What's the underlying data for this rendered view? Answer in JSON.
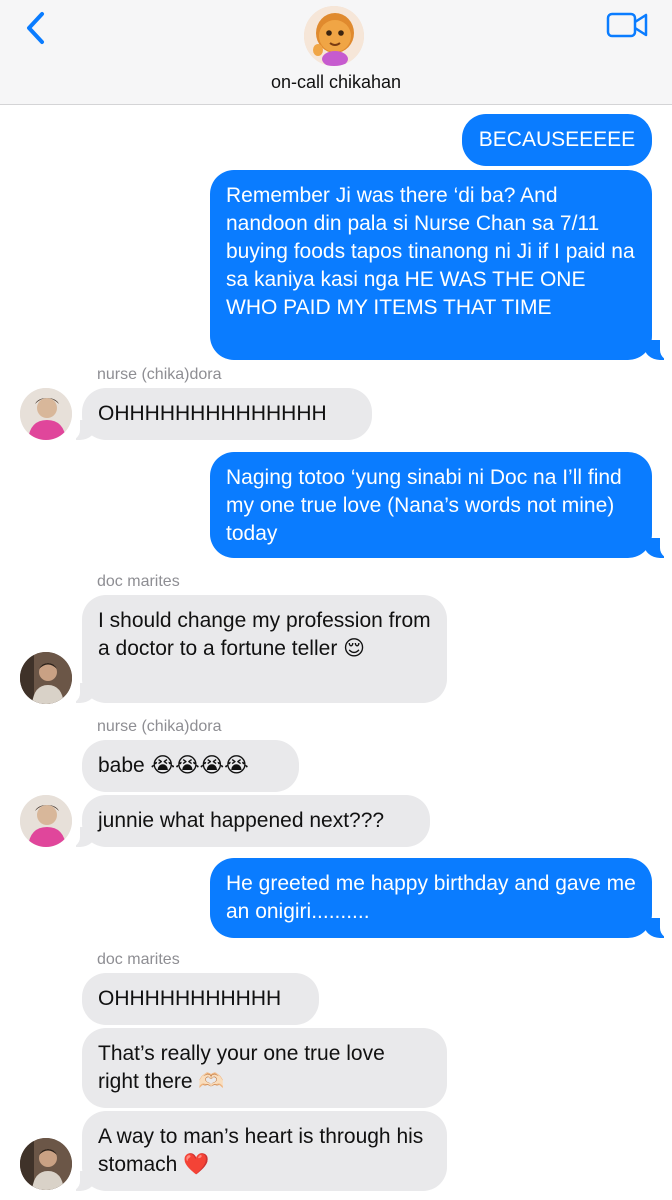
{
  "header": {
    "chat_title": "on-call chikahan"
  },
  "messages": [
    {
      "direction": "outgoing",
      "text": "BECAUSEEEEE"
    },
    {
      "direction": "outgoing",
      "text": "Remember Ji was there ‘di ba? And nandoon din pala si Nurse Chan sa 7/11 buying foods tapos tinanong ni Ji if I paid na sa kaniya kasi nga HE WAS THE ONE WHO PAID MY ITEMS THAT TIME"
    },
    {
      "direction": "incoming",
      "sender": "nurse (chika)dora",
      "text": "OHHHHHHHHHHHHHH"
    },
    {
      "direction": "outgoing",
      "text": "Naging totoo ‘yung sinabi ni Doc na I’ll find my one true love (Nana’s words not mine) today"
    },
    {
      "direction": "incoming",
      "sender": "doc marites",
      "text": "I should change my profession from a doctor to a fortune teller 😌"
    },
    {
      "direction": "incoming",
      "sender": "nurse (chika)dora",
      "text": "babe 😭😭😭😭"
    },
    {
      "direction": "incoming",
      "sender": "nurse (chika)dora",
      "text": "junnie what happened next???"
    },
    {
      "direction": "outgoing",
      "text": "He greeted me happy birthday and gave me an onigiri.........."
    },
    {
      "direction": "incoming",
      "sender": "doc marites",
      "text": "OHHHHHHHHHHH"
    },
    {
      "direction": "incoming",
      "sender": "doc marites",
      "text": "That’s really your one true love right there 🫶🏻"
    },
    {
      "direction": "incoming",
      "sender": "doc marites",
      "text": "A way to man’s heart is through his stomach ❤️"
    }
  ],
  "colors": {
    "outgoing_bubble": "#0a7cff",
    "incoming_bubble": "#e9e9eb",
    "accent": "#0a7cff",
    "header_bg": "#f6f6f7"
  },
  "icons": {
    "back": "chevron-left-icon",
    "video": "video-camera-icon"
  }
}
